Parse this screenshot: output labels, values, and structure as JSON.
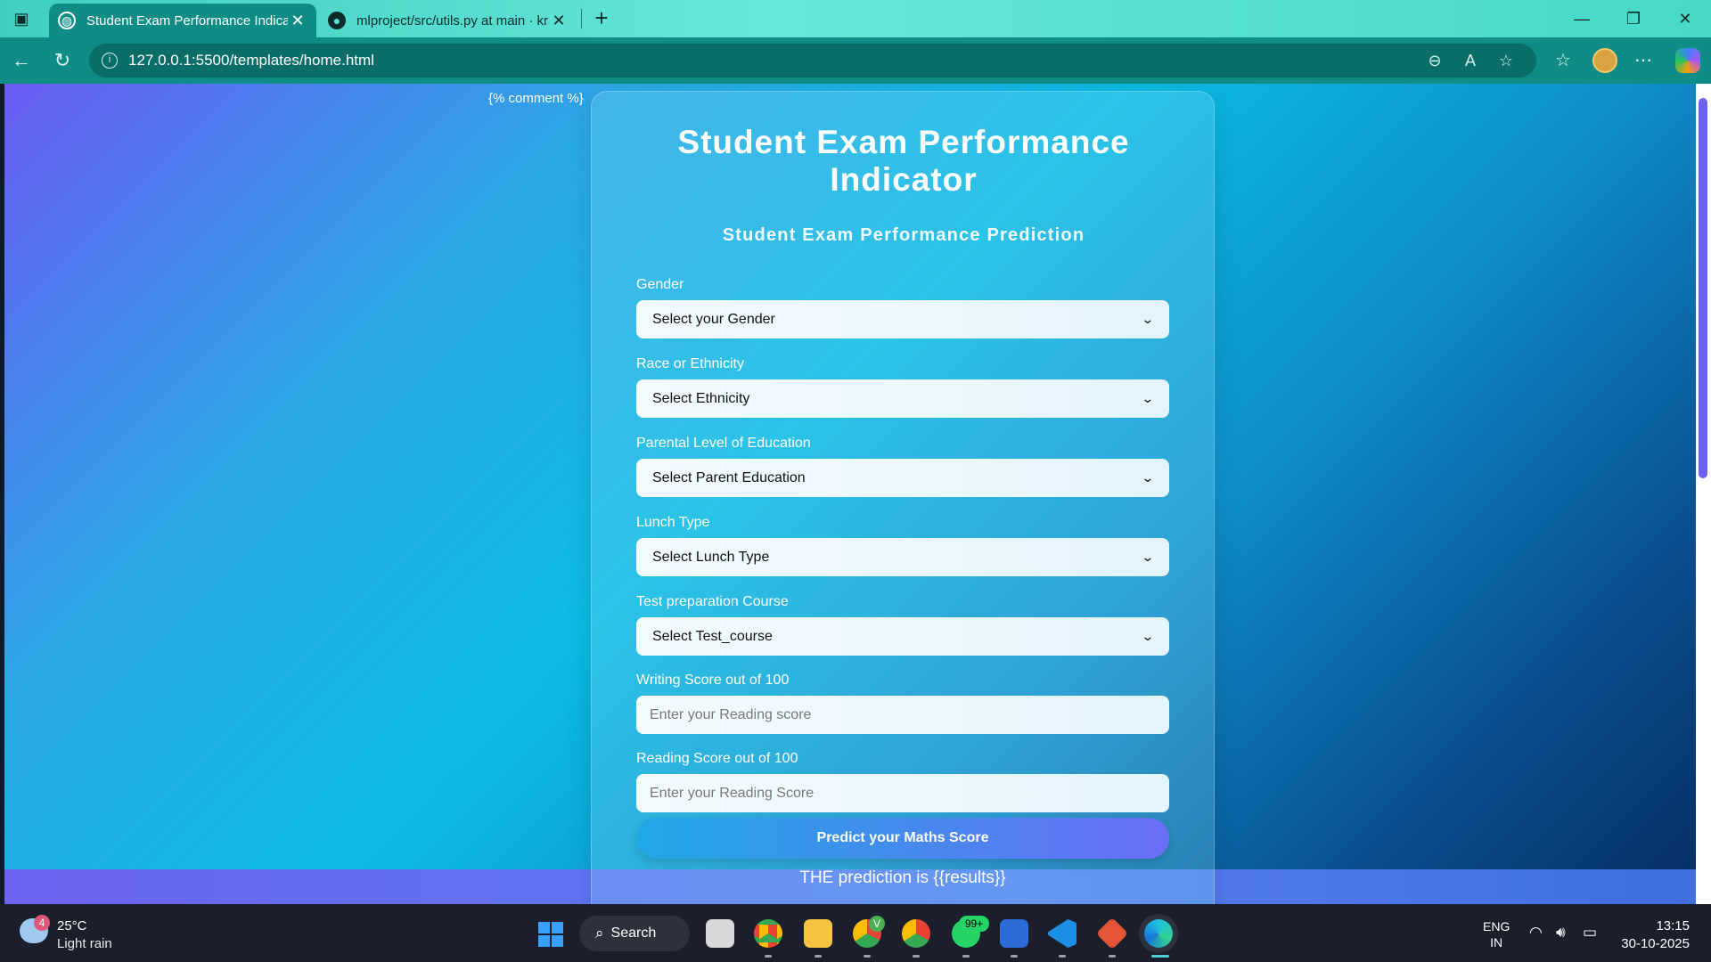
{
  "browser": {
    "tabs": [
      {
        "title": "Student Exam Performance Indica",
        "icon": "globe-icon",
        "active": true
      },
      {
        "title": "mlproject/src/utils.py at main · kri",
        "icon": "github-icon",
        "active": false
      }
    ],
    "url": "127.0.0.1:5500/templates/home.html"
  },
  "page": {
    "comment_tag": "{% comment %}",
    "title": "Student Exam Performance Indicator",
    "subtitle": "Student Exam Performance Prediction",
    "fields": [
      {
        "label": "Gender",
        "value": "Select your Gender",
        "type": "select"
      },
      {
        "label": "Race or Ethnicity",
        "value": "Select Ethnicity",
        "type": "select"
      },
      {
        "label": "Parental Level of Education",
        "value": "Select Parent Education",
        "type": "select"
      },
      {
        "label": "Lunch Type",
        "value": "Select Lunch Type",
        "type": "select"
      },
      {
        "label": "Test preparation Course",
        "value": "Select Test_course",
        "type": "select"
      },
      {
        "label": "Writing Score out of 100",
        "placeholder": "Enter your Reading score",
        "type": "input"
      },
      {
        "label": "Reading Score out of 100",
        "placeholder": "Enter your Reading Score",
        "type": "input"
      }
    ],
    "predict_button": "Predict your Maths Score",
    "result_text": "THE prediction is {{results}}"
  },
  "taskbar": {
    "weather_temp": "25°C",
    "weather_desc": "Light rain",
    "weather_badge": "4",
    "search_label": "Search",
    "whatsapp_badge": "99+",
    "chrome_badge": "V",
    "lang_line1": "ENG",
    "lang_line2": "IN",
    "time": "13:15",
    "date": "30-10-2025"
  },
  "colors": {
    "accent": "#0f8c86",
    "button_start": "#1fa8e6",
    "button_end": "#6b6ef6"
  }
}
